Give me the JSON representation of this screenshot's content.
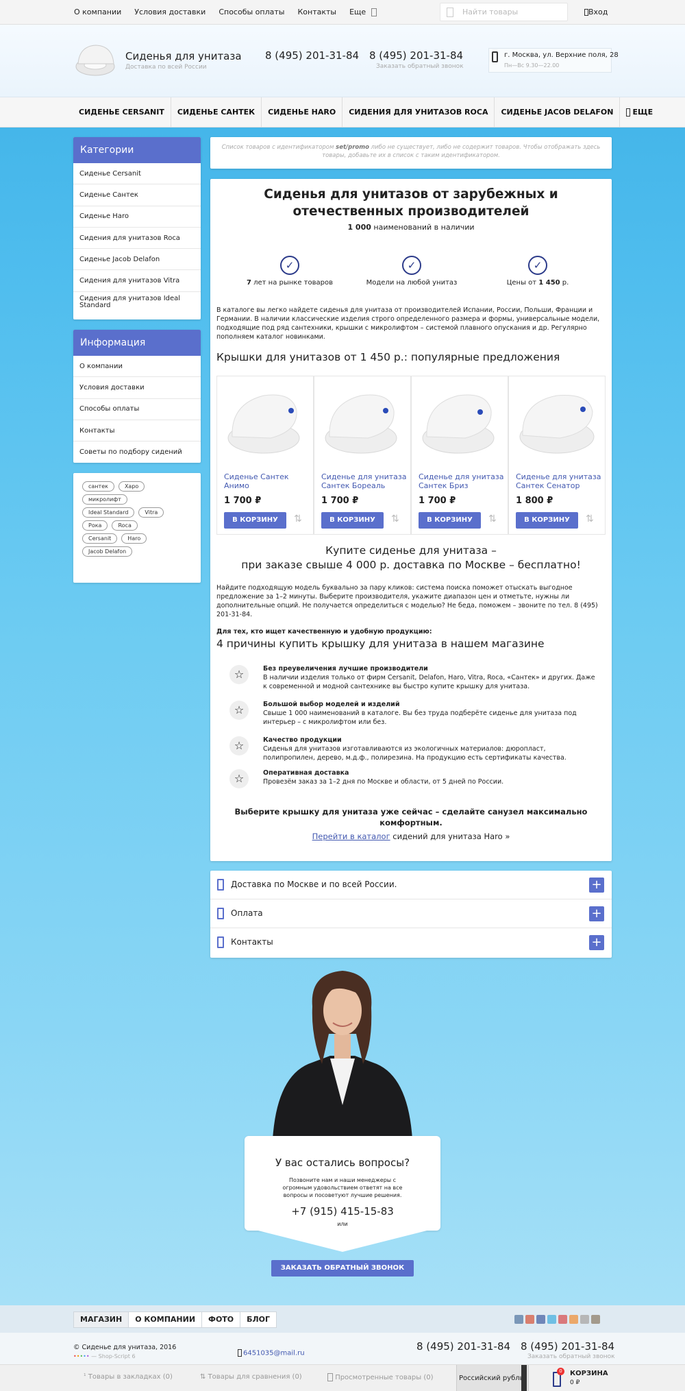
{
  "topnav": {
    "items": [
      "О компании",
      "Условия доставки",
      "Способы оплаты",
      "Контакты",
      "Еще"
    ],
    "search_placeholder": "Найти товары",
    "login": "Вход"
  },
  "header": {
    "brand": "Сиденья для унитаза",
    "tagline": "Доставка по всей России",
    "phone1": "8 (495) 201-31-84",
    "phone2": "8 (495) 201-31-84",
    "callback": "Заказать обратный звонок",
    "address": "г. Москва, ул. Верхние поля, 28",
    "hours": "Пн—Вс 9.30—22.00"
  },
  "menu": {
    "items": [
      "СИДЕНЬЕ CERSANIT",
      "СИДЕНЬЕ САНТЕК",
      "СИДЕНЬЕ HARO",
      "СИДЕНИЯ ДЛЯ УНИТАЗОВ ROCA",
      "СИДЕНЬЕ JACOB DELAFON"
    ],
    "more": "ЕЩЕ"
  },
  "categories": {
    "title": "Категории",
    "items": [
      "Сиденье Cersanit",
      "Сиденье Сантек",
      "Сиденье Haro",
      "Сидения для унитазов Roca",
      "Сиденье Jacob Delafon",
      "Сидения для унитазов Vitra",
      "Сидения для унитазов Ideal Standard"
    ]
  },
  "info": {
    "title": "Информация",
    "items": [
      "О компании",
      "Условия доставки",
      "Способы оплаты",
      "Контакты",
      "Советы по подбору сидений"
    ]
  },
  "tags": [
    "сантек",
    "Харо",
    "микролифт",
    "Ideal Standard",
    "Vitra",
    "Рока",
    "Roca",
    "Cersanit",
    "Haro",
    "Jacob Delafon"
  ],
  "notice": {
    "pre": "Список товаров с идентификатором ",
    "id": "set/promo",
    "post": " либо не существует, либо не содержит товаров. Чтобы отображать здесь товары, добавьте их в список с таким идентификатором."
  },
  "main": {
    "title": "Сиденья для унитазов от зарубежных и отечественных производителей",
    "count_num": "1 000",
    "count_text": " наименований в наличии",
    "features": [
      {
        "bold": "7",
        "text": " лет на рынке товаров",
        "after": ""
      },
      {
        "bold": "",
        "text": "Модели на любой унитаз",
        "after": ""
      },
      {
        "bold": "1 450",
        "text": "Цены от ",
        "after": " р."
      }
    ],
    "intro": "В каталоге вы легко найдете сиденья для унитаза от производителей Испании, России, Польши, Франции и Германии. В наличии классические изделия строго определенного размера и формы, универсальные модели, подходящие под ряд сантехники, крышки с микролифтом – системой плавного опускания и др. Регулярно пополняем каталог новинками.",
    "popular_title": "Крышки для унитазов от 1 450 р.: популярные предложения",
    "products": [
      {
        "name": "Сиденье Сантек Анимо",
        "price": "1 700 ₽"
      },
      {
        "name": "Сиденье для унитаза Сантек Бореаль",
        "price": "1 700 ₽"
      },
      {
        "name": "Сиденье для унитаза Сантек Бриз",
        "price": "1 700 ₽"
      },
      {
        "name": "Сиденье для унитаза Сантек Сенатор",
        "price": "1 800 ₽"
      }
    ],
    "cart_btn": "В КОРЗИНУ",
    "promo1": "Купите сиденье для унитаза –",
    "promo2": "при заказе свыше 4 000 р. доставка по Москве – бесплатно!",
    "para2": "Найдите подходящую модель буквально за пару кликов: система поиска поможет отыскать выгодное предложение за 1–2 минуты. Выберите производителя, укажите диапазон цен и отметьте, нужны ли дополнительные опций. Не получается определиться с моделью? Не беда, поможем – звоните по тел. 8 (495) 201-31-84.",
    "for_whom": "Для тех, кто ищет качественную и удобную продукцию:",
    "reasons_title": "4 причины купить крышку для унитаза в нашем магазине",
    "reasons": [
      {
        "t": "Без преувеличения лучшие производители",
        "d": "В наличии изделия только от фирм Cersanit, Delafon, Haro, Vitra, Roca, «Сантек» и других. Даже к современной и модной сантехнике вы быстро купите крышку для унитаза."
      },
      {
        "t": "Большой выбор моделей и изделий",
        "d": "Свыше 1 000 наименований в каталоге. Вы без труда подберёте сиденье для унитаза под интерьер – с микролифтом или без."
      },
      {
        "t": "Качество продукции",
        "d": "Сиденья для унитазов изготавливаются из экологичных материалов: дюропласт, полипропилен, дерево, м.д.ф., полирезина. На продукцию есть сертификаты качества."
      },
      {
        "t": "Оперативная доставка",
        "d": "Провезём заказ за 1–2 дня по Москве и области, от 5 дней по России."
      }
    ],
    "cta": "Выберите крышку для унитаза уже сейчас – сделайте санузел максимально комфортным.",
    "link": "Перейти в каталог",
    "link_after": " сидений для унитаза Haro »"
  },
  "accordion": [
    "Доставка по Москве и по всей России.",
    "Оплата",
    "Контакты"
  ],
  "questions": {
    "title": "У вас остались вопросы?",
    "text": "Позвоните нам и наши менеджеры с огромным удовольствием ответят на все вопросы и посоветуют лучшие решения.",
    "phone": "+7 (915) 415-15-83",
    "or": "или",
    "button": "ЗАКАЗАТЬ ОБРАТНЫЙ ЗВОНОК"
  },
  "footer": {
    "nav": [
      "МАГАЗИН",
      "О КОМПАНИИ",
      "ФОТО",
      "БЛОГ"
    ],
    "copy": "© Сиденье для унитаза, 2016",
    "powered": "— Shop-Script 6",
    "email": "6451035@mail.ru",
    "phone1": "8 (495) 201-31-84",
    "phone2": "8 (495) 201-31-84",
    "callback": "Заказать обратный звонок"
  },
  "bottom": {
    "bookmarks": "Товары в закладках (0)",
    "compare": "Товары для сравнения (0)",
    "viewed": "Просмотренные товары (0)",
    "currency": "Российский рубль",
    "cart": "КОРЗИНА",
    "cart_sum": "0 ₽",
    "cart_count": "0"
  }
}
